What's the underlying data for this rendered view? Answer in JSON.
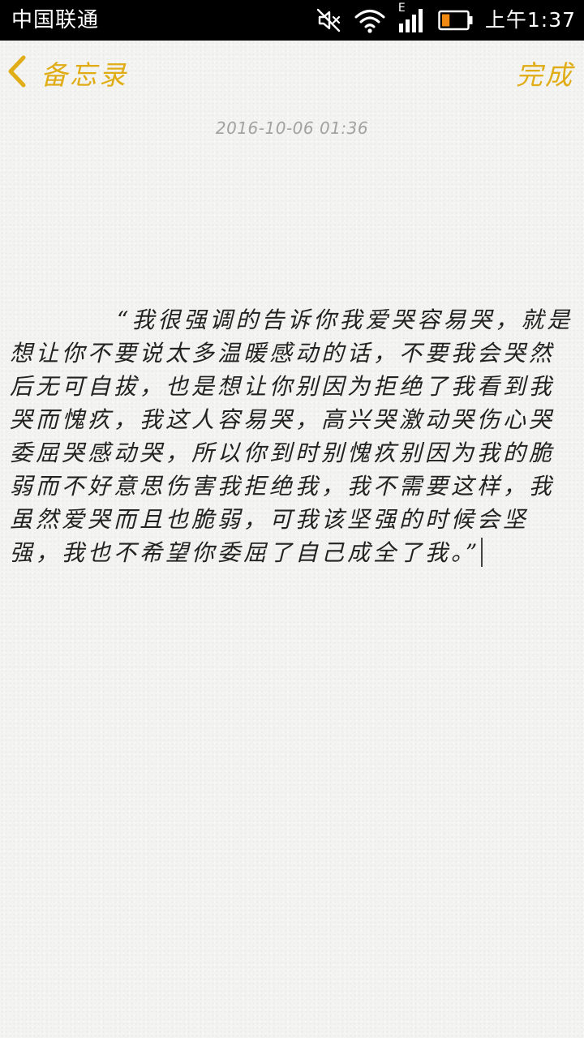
{
  "status_bar": {
    "carrier": "中国联通",
    "network_type": "E",
    "time": "上午1:37",
    "icons": [
      "mute-icon",
      "wifi-icon",
      "signal-icon",
      "battery-icon"
    ],
    "battery_level": 0.25
  },
  "nav": {
    "back_label": "备忘录",
    "done_label": "完成"
  },
  "note": {
    "timestamp": "2016-10-06 01:36",
    "body": "“我很强调的告诉你我爱哭容易哭，就是想让你不要说太多温暖感动的话，不要我会哭然后无可自拔，也是想让你别因为拒绝了我看到我哭而愧疚，我这人容易哭，高兴哭激动哭伤心哭委屈哭感动哭，所以你到时别愧疚别因为我的脆弱而不好意思伤害我拒绝我，我不需要这样，我虽然爱哭而且也脆弱，可我该坚强的时候会坚强，我也不希望你委屈了自己成全了我。”"
  },
  "colors": {
    "accent": "#e0ad17",
    "status_bar_bg": "#000000",
    "paper": "#f3f3f1",
    "timestamp": "#a2a2a0",
    "text": "#222222"
  }
}
